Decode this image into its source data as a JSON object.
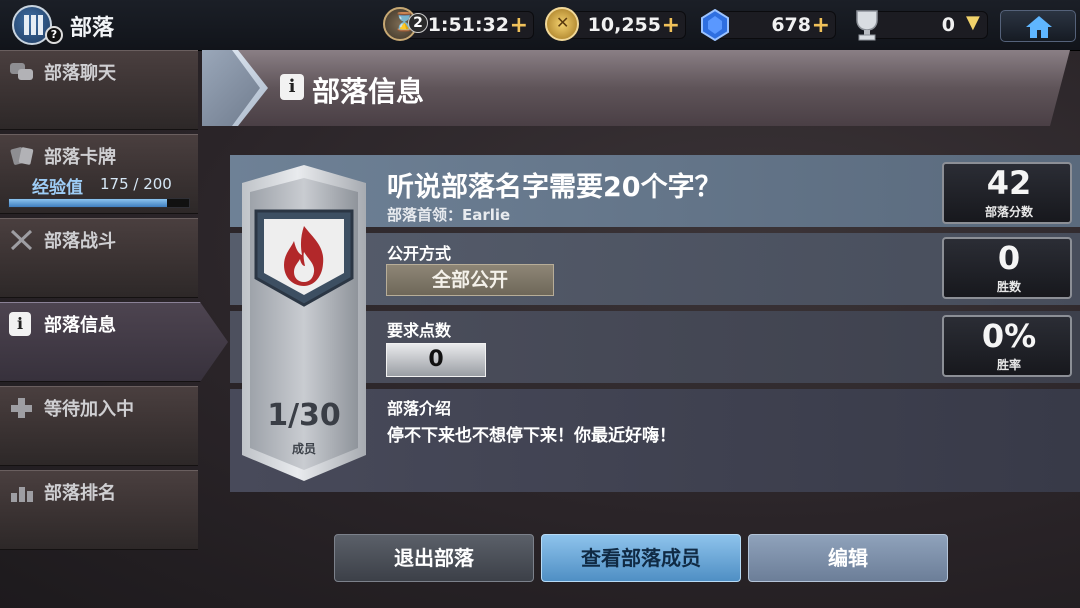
{
  "topbar": {
    "title": "部落",
    "help_badge": "?",
    "timer_count": "2",
    "timer_value": "1:51:32",
    "gold_value": "10,255",
    "gems_value": "678",
    "trophy_value": "0",
    "plus_symbol": "+"
  },
  "sidebar": {
    "items": [
      {
        "label": "部落聊天",
        "icon": "chat-icon"
      },
      {
        "label": "部落卡牌",
        "icon": "cards-icon"
      },
      {
        "label": "部落战斗",
        "icon": "crossed-swords-icon"
      },
      {
        "label": "部落信息",
        "icon": "info-icon"
      },
      {
        "label": "等待加入中",
        "icon": "plus-icon"
      },
      {
        "label": "部落排名",
        "icon": "ranking-icon"
      }
    ],
    "exp_label": "经验值",
    "exp_value": "175 / 200",
    "exp_progress": 0.875
  },
  "header": {
    "info_icon": "i",
    "title": "部落信息"
  },
  "clan": {
    "name": "听说部落名字需要20个字？",
    "leader": "部落首领：Earlie",
    "access_label": "公开方式",
    "access_value": "全部公开",
    "required_points_label": "要求点数",
    "required_points_value": "0",
    "intro_label": "部落介绍",
    "intro_text": "停不下来也不想停下来！你最近好嗨！",
    "member_count": "1/30",
    "member_label": "成员"
  },
  "stats": {
    "score_value": "42",
    "score_label": "部落分数",
    "wins_value": "0",
    "wins_label": "胜数",
    "winrate_value": "0%",
    "winrate_label": "胜率"
  },
  "buttons": {
    "leave": "退出部落",
    "view_members": "查看部落成员",
    "edit": "编辑"
  },
  "colors": {
    "accent_blue": "#8ec3ec",
    "flame_red": "#b2282a",
    "gold": "#f0c15a"
  }
}
